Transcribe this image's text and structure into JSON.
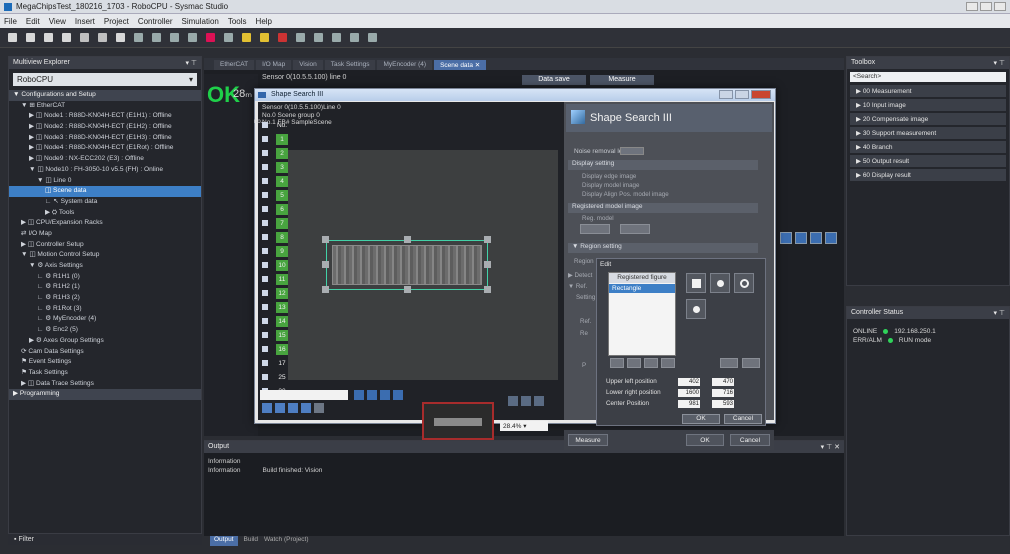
{
  "window": {
    "title": "MegaChipsTest_180216_1703 - RoboCPU - Sysmac Studio"
  },
  "menu": [
    "File",
    "Edit",
    "View",
    "Insert",
    "Project",
    "Controller",
    "Simulation",
    "Tools",
    "Help"
  ],
  "explorer": {
    "title": "Multiview Explorer",
    "device": "RoboCPU",
    "tree": [
      {
        "label": "▼ Configurations and Setup",
        "indent": 0,
        "kind": "section"
      },
      {
        "label": "▼ ⊞ EtherCAT",
        "indent": 1
      },
      {
        "label": "▶ ◫ Node1 : R88D-KN04H-ECT (E1H1) : Offline",
        "indent": 2
      },
      {
        "label": "▶ ◫ Node2 : R88D-KN04H-ECT (E1H2) : Offline",
        "indent": 2
      },
      {
        "label": "▶ ◫ Node3 : R88D-KN04H-ECT (E1H3) : Offline",
        "indent": 2
      },
      {
        "label": "▶ ◫ Node4 : R88D-KN04H-ECT (E1Rot) : Offline",
        "indent": 2
      },
      {
        "label": "▶ ◫ Node9 : NX-ECC202 (E3) : Offline",
        "indent": 2
      },
      {
        "label": "▼ ◫ Node10 : FH-3050-10 v5.5 (FH) : Online",
        "indent": 2
      },
      {
        "label": "▼ ◫ Line 0",
        "indent": 3
      },
      {
        "label": "◫ Scene data",
        "indent": 4,
        "kind": "selected"
      },
      {
        "label": "∟ ↖ System data",
        "indent": 4
      },
      {
        "label": "▶ ⛭ Tools",
        "indent": 4
      },
      {
        "label": "▶ ◫ CPU/Expansion Racks",
        "indent": 1
      },
      {
        "label": "⇄ I/O Map",
        "indent": 1
      },
      {
        "label": "▶ ◫ Controller Setup",
        "indent": 1
      },
      {
        "label": "▼ ◫ Motion Control Setup",
        "indent": 1
      },
      {
        "label": "▼ ⚙ Axis Settings",
        "indent": 2
      },
      {
        "label": "∟ ⚙ R1H1 (0)",
        "indent": 3
      },
      {
        "label": "∟ ⚙ R1H2 (1)",
        "indent": 3
      },
      {
        "label": "∟ ⚙ R1H3 (2)",
        "indent": 3
      },
      {
        "label": "∟ ⚙ R1Rot (3)",
        "indent": 3
      },
      {
        "label": "∟ ⚙ MyEncoder (4)",
        "indent": 3
      },
      {
        "label": "∟ ⚙ Enc2 (5)",
        "indent": 3
      },
      {
        "label": "▶ ⚙ Axes Group Settings",
        "indent": 2
      },
      {
        "label": "⟳ Cam Data Settings",
        "indent": 1
      },
      {
        "label": "⚑ Event Settings",
        "indent": 1
      },
      {
        "label": "⚑ Task Settings",
        "indent": 1
      },
      {
        "label": "▶ ◫ Data Trace Settings",
        "indent": 1
      },
      {
        "label": "▶ Programming",
        "indent": 0,
        "kind": "section"
      }
    ],
    "filter": "Filter"
  },
  "tabs": [
    {
      "label": "EtherCAT",
      "active": false
    },
    {
      "label": "I/O Map",
      "active": false
    },
    {
      "label": "Vision",
      "active": false
    },
    {
      "label": "Task Settings",
      "active": false
    },
    {
      "label": "MyEncoder (4)",
      "active": false
    },
    {
      "label": "Scene data ✕",
      "active": true
    }
  ],
  "main": {
    "ok_label": "OK",
    "ok_count": "28ₘ",
    "sensor_line": "Sensor 0(10.5.5.100) line 0",
    "data_save": "Data save",
    "measure": "Measure",
    "id_rows": [
      {
        "num": "No.",
        "green": false
      },
      {
        "num": "1",
        "green": true
      },
      {
        "num": "2",
        "green": true
      },
      {
        "num": "3",
        "green": true
      },
      {
        "num": "4",
        "green": true
      },
      {
        "num": "5",
        "green": true
      },
      {
        "num": "6",
        "green": true
      },
      {
        "num": "7",
        "green": true
      },
      {
        "num": "8",
        "green": true
      },
      {
        "num": "9",
        "green": true
      },
      {
        "num": "10",
        "green": true
      },
      {
        "num": "11",
        "green": true
      },
      {
        "num": "12",
        "green": true
      },
      {
        "num": "13",
        "green": true
      },
      {
        "num": "14",
        "green": true
      },
      {
        "num": "15",
        "green": true
      },
      {
        "num": "16",
        "green": true
      },
      {
        "num": "17",
        "green": false
      },
      {
        "num": "25",
        "green": false
      },
      {
        "num": "30",
        "green": false
      }
    ]
  },
  "output": {
    "title": "Output",
    "rows": [
      {
        "type": "Information",
        "text": ""
      },
      {
        "type": "Information",
        "text": "Build finished: Vision"
      }
    ],
    "bottom_tabs": [
      "Output",
      "Build",
      "Watch (Project)"
    ]
  },
  "toolbox": {
    "title": "Toolbox",
    "search": "<Search>",
    "items": [
      "00 Measurement",
      "10 Input image",
      "20 Compensate image",
      "30 Support measurement",
      "40 Branch",
      "50 Output result",
      "60 Display result"
    ]
  },
  "controller_status": {
    "title": "Controller Status",
    "rows": [
      {
        "label": "ONLINE",
        "value": "192.168.250.1"
      },
      {
        "label": "ERR/ALM",
        "value": "RUN mode"
      }
    ]
  },
  "dialog": {
    "title": "Shape Search III",
    "sensor_lines": [
      "Sensor 0(10.5.5.100)Line 0",
      "No.0 Scene group 0",
      "No.1 FB# SampleScene"
    ],
    "no_mark": "no.",
    "header": "Shape Search III",
    "settings": {
      "noise_removal": "Noise removal level :",
      "display_setting": "Display setting",
      "display_options": [
        "Display edge image",
        "Display model image",
        "Display Align Pos. model image"
      ],
      "registered_model": "Registered model image",
      "reg_model": "Reg. model",
      "region_setting": "▼ Region setting",
      "region": "Region",
      "detect": "▶ Detect",
      "ref": "▼ Ref.",
      "setting": "Setting",
      "ref_label": "Ref.",
      "re_label": "Re",
      "p_label": "P"
    },
    "edit": {
      "title": "Edit",
      "registered_figure": "Registered figure",
      "selected": "Rectangle",
      "upper_left": "Upper left position",
      "lower_right": "Lower right position",
      "center": "Center Position",
      "upper_left_x": "402",
      "upper_left_y": "470",
      "lower_right_x": "1600",
      "lower_right_y": "716",
      "center_x": "981",
      "center_y": "593",
      "ok": "OK",
      "cancel": "Cancel"
    },
    "zoom": "28.4%",
    "footer": {
      "measure": "Measure",
      "ok": "OK",
      "cancel": "Cancel"
    }
  }
}
